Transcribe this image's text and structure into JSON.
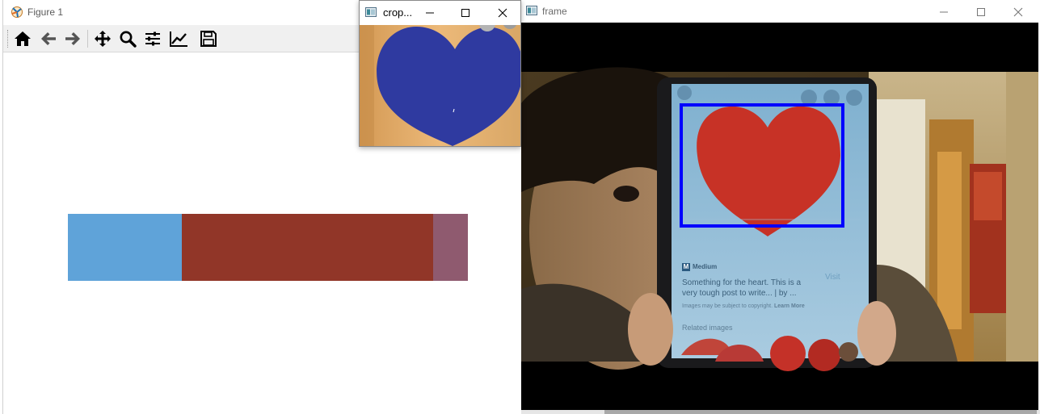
{
  "figure_window": {
    "title": "Figure 1",
    "toolbar": [
      {
        "name": "home-icon",
        "tooltip": "Home"
      },
      {
        "name": "back-arrow-icon",
        "tooltip": "Back"
      },
      {
        "name": "forward-arrow-icon",
        "tooltip": "Forward"
      },
      {
        "name": "pan-icon",
        "tooltip": "Pan"
      },
      {
        "name": "zoom-icon",
        "tooltip": "Zoom"
      },
      {
        "name": "subplots-config-icon",
        "tooltip": "Configure subplots"
      },
      {
        "name": "edit-axes-icon",
        "tooltip": "Edit axis"
      },
      {
        "name": "save-icon",
        "tooltip": "Save"
      }
    ],
    "color_bar": {
      "segments": [
        {
          "color": "#5fa3d9",
          "fraction": 0.285
        },
        {
          "color": "#913628",
          "fraction": 0.628
        },
        {
          "color": "#8f5a6f",
          "fraction": 0.087
        }
      ]
    }
  },
  "crop_window": {
    "title": "crop...",
    "heart_color": "#2f3aa0",
    "background_color": "#e0a864"
  },
  "frame_window": {
    "title": "frame",
    "phone": {
      "source_name": "Medium",
      "caption_line1": "Something for the heart. This is a",
      "caption_line2": "very tough post to write... | by ...",
      "visit_label": "Visit",
      "copyright_text": "Images may be subject to copyright.",
      "learn_more": "Learn More",
      "related_label": "Related images"
    },
    "heart_color": "#c73226",
    "detection_box_color": "#0000ff"
  }
}
